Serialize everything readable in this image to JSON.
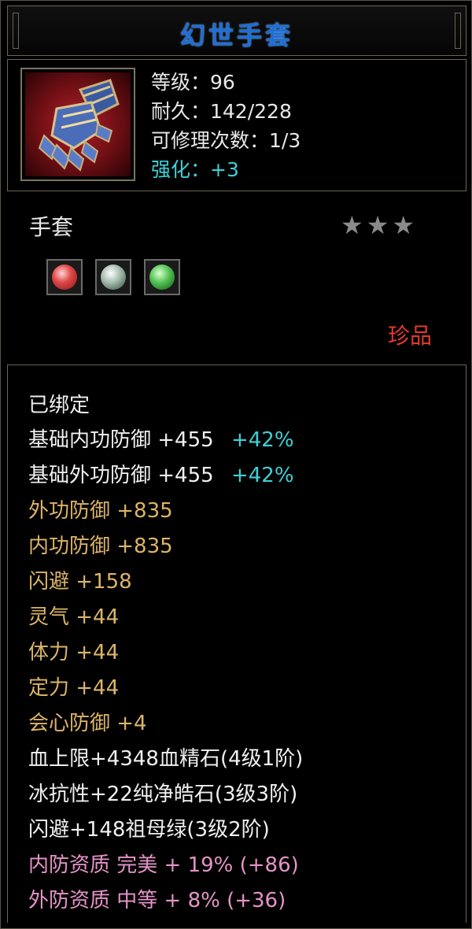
{
  "title": "幻世手套",
  "item": {
    "icon": "gauntlet-icon",
    "type": "手套",
    "stars": "★★★",
    "rarity": "珍品"
  },
  "stats": {
    "level": "等级：96",
    "durability": "耐久：142/228",
    "repairs": "可修理次数：1/3",
    "enhance": "强化：+3"
  },
  "gems": [
    {
      "name": "blood-essence-gem"
    },
    {
      "name": "pure-diamond-gem"
    },
    {
      "name": "emerald-gem"
    }
  ],
  "attributes": {
    "bound": "已绑定",
    "base_inner_def": {
      "label": "基础内功防御  +455",
      "bonus": "+42%"
    },
    "base_outer_def": {
      "label": "基础外功防御  +455",
      "bonus": "+42%"
    },
    "outer_def": "外功防御  +835",
    "inner_def": "内功防御  +835",
    "dodge": "闪避  +158",
    "spirit": "灵气  +44",
    "stamina": "体力  +44",
    "focus": "定力  +44",
    "crit_def": "会心防御  +4",
    "gem1": "血上限+4348血精石(4级1阶)",
    "gem2": "冰抗性+22纯净皓石(3级3阶)",
    "gem3": "闪避+148祖母绿(3级2阶)",
    "inner_quality": "内防资质  完美  + 19% (+86)",
    "outer_quality": "外防资质  中等  + 8% (+36)"
  },
  "colors": {
    "title": "#1d6fd8",
    "cyan": "#3fd0d6",
    "gold": "#dcb468",
    "pink": "#e594c8",
    "rarity": "#e23a2c"
  }
}
